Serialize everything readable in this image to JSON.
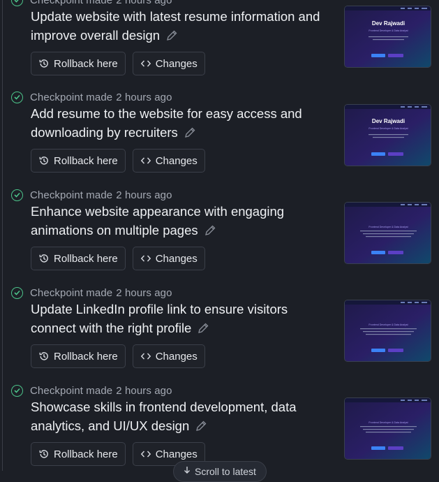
{
  "checkpoint_label": "Checkpoint made",
  "checkpoint_time": "2 hours ago",
  "rollback_label": "Rollback here",
  "changes_label": "Changes",
  "scroll_latest_label": "Scroll to latest",
  "entries": [
    {
      "title": "Update website with latest resume information and improve overall design",
      "thumb": {
        "name": "Dev Rajwadi",
        "subtitle": "Frontend Developer & Data Analyst"
      }
    },
    {
      "title": "Add resume to the website for easy access and downloading by recruiters",
      "thumb": {
        "name": "Dev Rajwadi",
        "subtitle": "Frontend Developer & Data Analyst"
      }
    },
    {
      "title": "Enhance website appearance with engaging animations on multiple pages",
      "thumb": {
        "name": "",
        "subtitle": "Frontend Developer & Data Analyst"
      }
    },
    {
      "title": "Update LinkedIn profile link to ensure visitors connect with the right profile",
      "thumb": {
        "name": "",
        "subtitle": "Frontend Developer & Data Analyst"
      }
    },
    {
      "title": "Showcase skills in frontend development, data analytics, and UI/UX design",
      "thumb": {
        "name": "",
        "subtitle": "Frontend Developer & Data Analyst"
      }
    }
  ],
  "colors": {
    "check": "#4cc38a",
    "background": "#1c1f26",
    "accent": "#3b82f6"
  }
}
